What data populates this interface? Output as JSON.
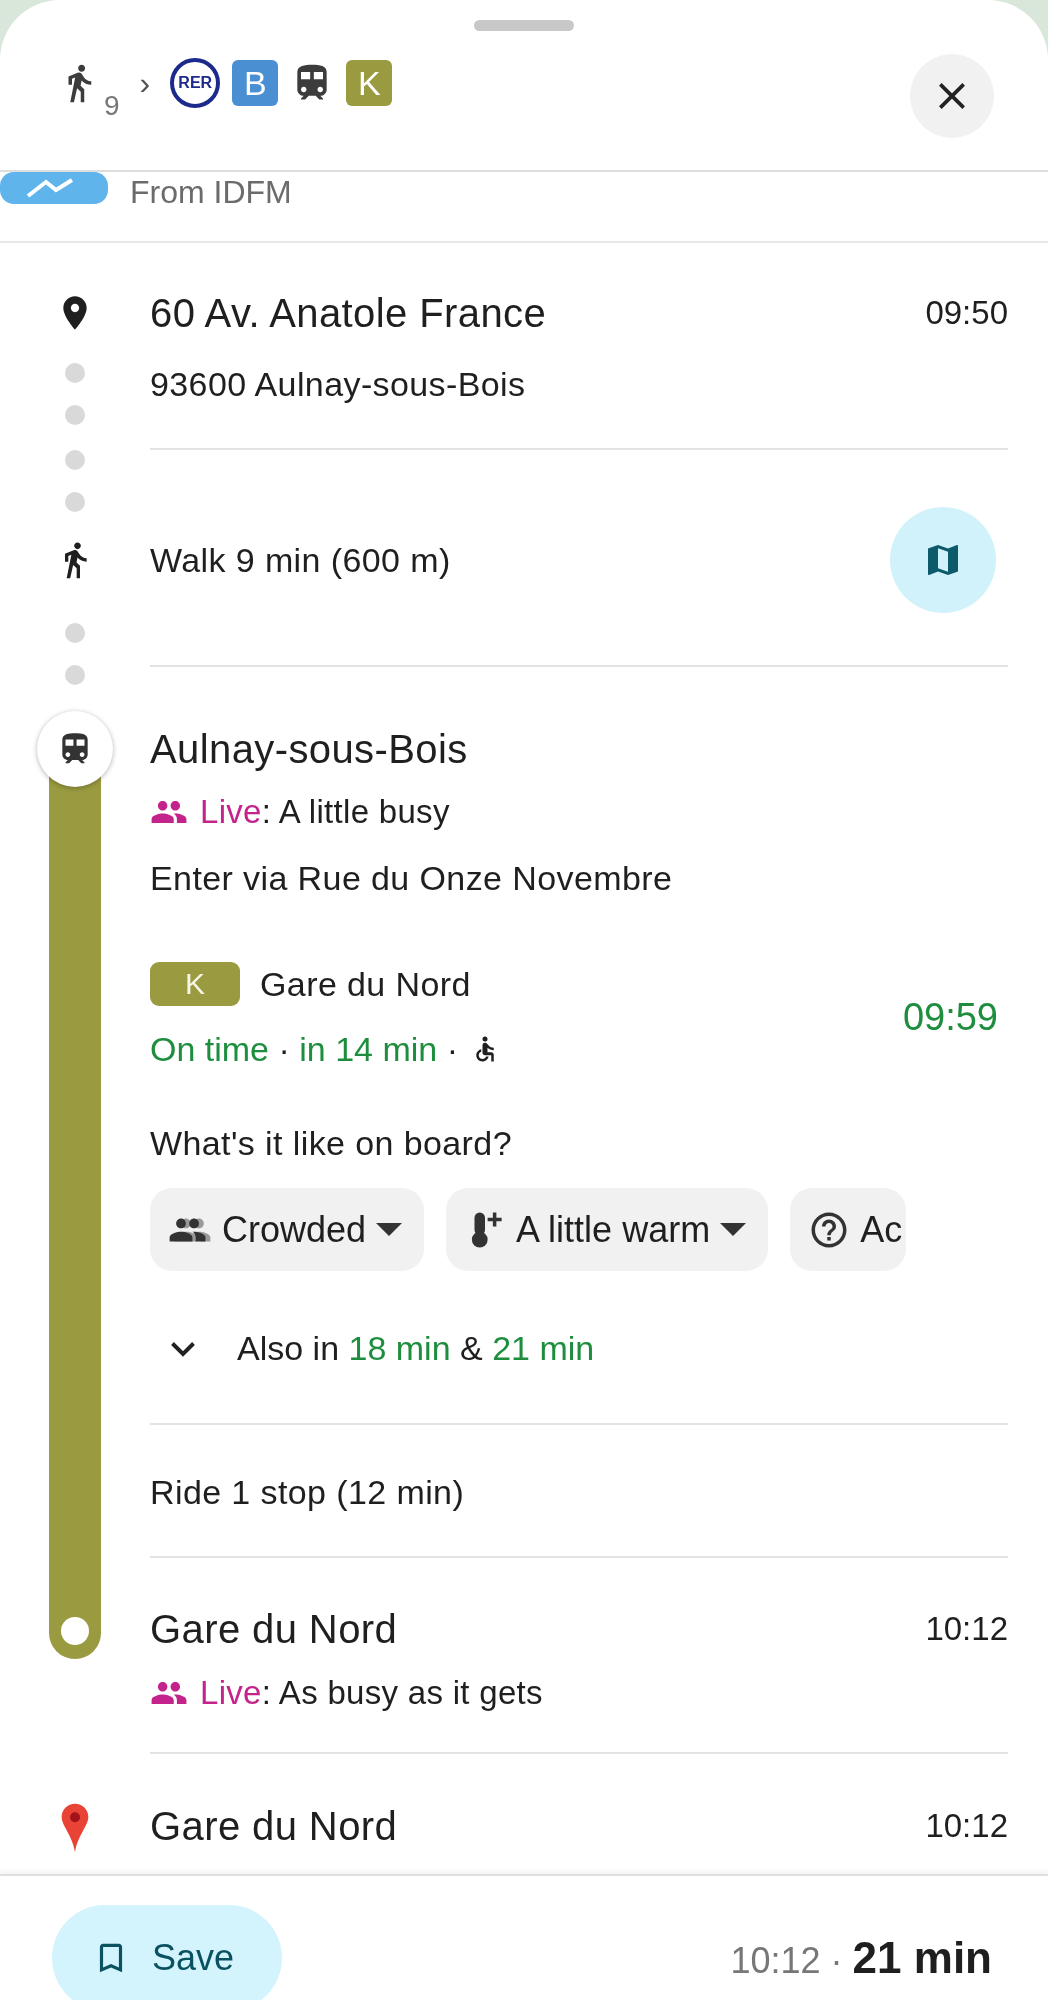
{
  "header": {
    "route": [
      {
        "kind": "walk",
        "minutes": "9"
      },
      {
        "kind": "separator",
        "text": "›"
      },
      {
        "kind": "network",
        "text": "RER"
      },
      {
        "kind": "line",
        "text": "B",
        "color": "#4a8fd1"
      },
      {
        "kind": "train"
      },
      {
        "kind": "line",
        "text": "K",
        "color": "#9a9a40"
      }
    ]
  },
  "source": {
    "text": "From IDFM"
  },
  "origin": {
    "name": "60 Av. Anatole France",
    "address": "93600 Aulnay-sous-Bois",
    "time": "09:50"
  },
  "walk": {
    "text": "Walk 9 min (600 m)"
  },
  "departure": {
    "station": "Aulnay-sous-Bois",
    "live": {
      "label": "Live",
      "text": ": A little busy"
    },
    "entrance": "Enter via Rue du Onze Novembre",
    "line": {
      "text": "K",
      "color": "#9a9a40"
    },
    "headsign": "Gare du Nord",
    "time": "09:59",
    "status": [
      {
        "text": "On time",
        "kind": "highlight"
      },
      {
        "text": "·",
        "kind": "plain"
      },
      {
        "text": "in 14 min",
        "kind": "highlight"
      },
      {
        "text": "·",
        "kind": "plain"
      }
    ],
    "question": "What's it like on board?",
    "chips": [
      {
        "kind": "crowd",
        "label": "Crowded"
      },
      {
        "kind": "temperature",
        "label": "A little warm"
      },
      {
        "kind": "help",
        "label": "Ac"
      }
    ],
    "also": {
      "expanded": false,
      "segments": [
        {
          "text": "Also in",
          "kind": "plain"
        },
        {
          "text": "18 min",
          "kind": "highlight"
        },
        {
          "text": "&",
          "kind": "plain"
        },
        {
          "text": "21 min",
          "kind": "highlight"
        }
      ]
    }
  },
  "ride": {
    "text": "Ride 1 stop (12 min)"
  },
  "arrival": {
    "station": "Gare du Nord",
    "time": "10:12",
    "live": {
      "label": "Live",
      "text": ": As busy as it gets"
    }
  },
  "destination": {
    "name": "Gare du Nord",
    "time": "10:12"
  },
  "footer": {
    "save": "Save",
    "arrival": "10:12",
    "separator": "·",
    "duration": "21 min"
  }
}
